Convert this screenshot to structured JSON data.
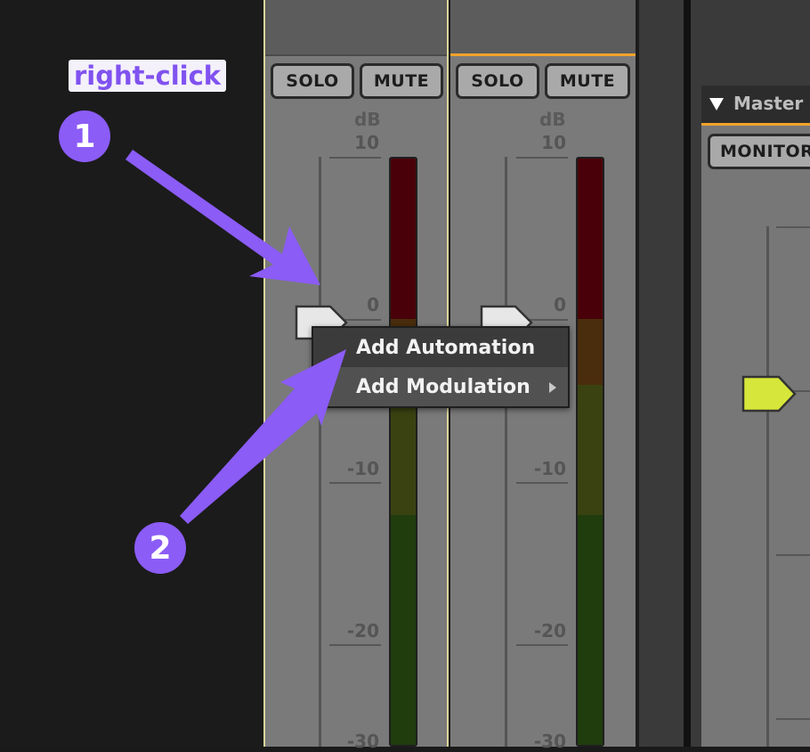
{
  "strips": [
    {
      "solo_label": "SOLO",
      "mute_label": "MUTE",
      "db_label": "dB",
      "scale": [
        "10",
        "0",
        "-10",
        "-20",
        "-30"
      ]
    },
    {
      "solo_label": "SOLO",
      "mute_label": "MUTE",
      "db_label": "dB",
      "scale": [
        "10",
        "0",
        "-10",
        "-20",
        "-30"
      ]
    }
  ],
  "master": {
    "title": "Master B",
    "monitor_label": "MONITOR",
    "collapse_glyph": "▼"
  },
  "context_menu": {
    "items": [
      {
        "label": "Add Automation"
      },
      {
        "label": "Add Modulation",
        "submenu_glyph": "▸"
      }
    ]
  },
  "annotation": {
    "hint": "right-click",
    "step1": "1",
    "step2": "2",
    "accent": "#8b5cf6"
  },
  "colors": {
    "strip_select": "#d9d59a",
    "strip_active": "#f2a22c",
    "master_fader": "#d6e63a"
  },
  "icons": {
    "collapse": "triangle-down-icon",
    "submenu": "chevron-right-icon",
    "fader": "fader-cap-icon"
  }
}
